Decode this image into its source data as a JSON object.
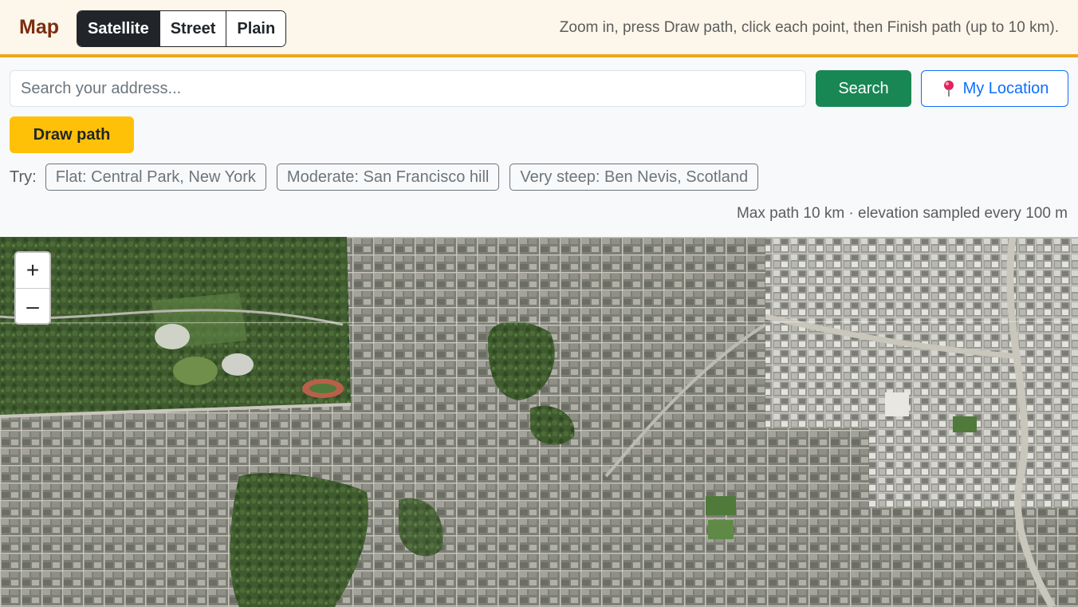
{
  "header": {
    "brand": "Map",
    "layers": [
      {
        "label": "Satellite",
        "active": true
      },
      {
        "label": "Street",
        "active": false
      },
      {
        "label": "Plain",
        "active": false
      }
    ],
    "hint": "Zoom in, press Draw path, click each point, then Finish path (up to 10 km)."
  },
  "search": {
    "placeholder": "Search your address...",
    "value": "",
    "button_label": "Search",
    "location_label": "My Location",
    "location_icon": "map-pin-icon"
  },
  "draw": {
    "label": "Draw path"
  },
  "try": {
    "label": "Try:",
    "examples": [
      "Flat: Central Park, New York",
      "Moderate: San Francisco hill",
      "Very steep: Ben Nevis, Scotland"
    ]
  },
  "note": "Max path 10 km · elevation sampled every 100 m",
  "map": {
    "zoom_in": "+",
    "zoom_out": "–",
    "colors": {
      "park": "#3e5a2e",
      "urban": "#8a8a82",
      "road": "#c9c6bc",
      "track": "#b9604a"
    }
  }
}
